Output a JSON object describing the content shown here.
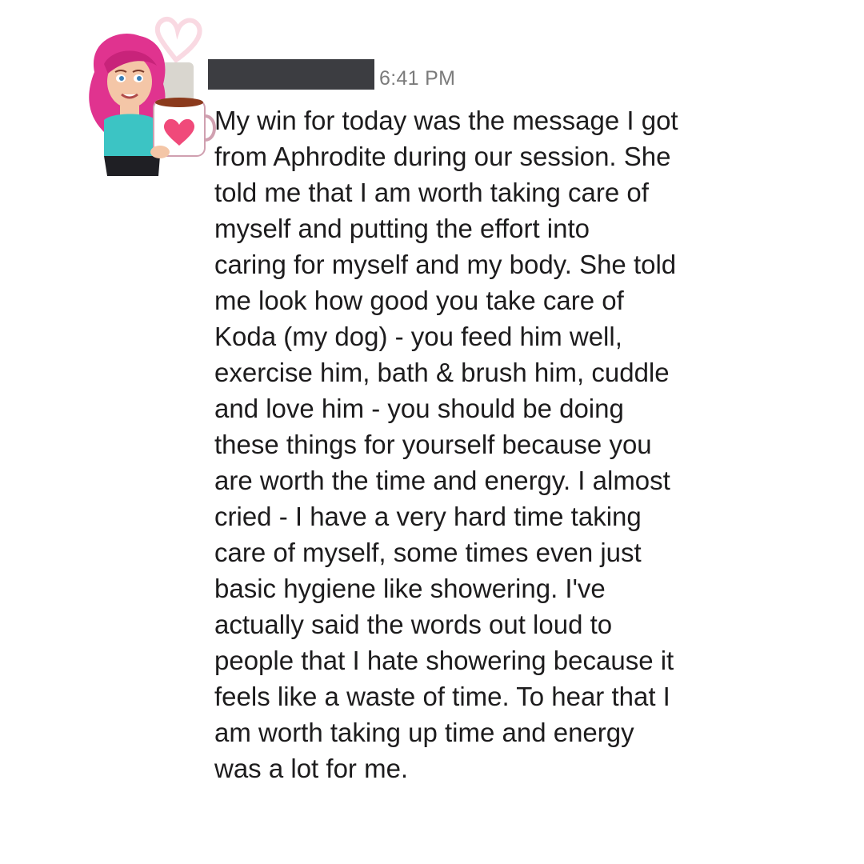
{
  "message": {
    "author_redacted": true,
    "timestamp": "6:41 PM",
    "text": "My win for today was the message I got\nfrom Aphrodite during our session. She\ntold me that I am worth taking care of\nmyself and putting the effort into\ncaring for myself and my body. She told\nme look how good you take care of\nKoda (my dog) - you feed him well,\nexercise him, bath & brush him, cuddle\nand love him - you should be doing\nthese things for yourself because you\nare worth the time and energy. I almost\ncried - I have a very hard time taking\ncare of myself, some times even just\nbasic hygiene like showering. I've\nactually said the words out loud to\npeople that I hate showering because it\nfeels like a waste of time. To hear that I\nam worth taking up time and energy\nwas a lot for me."
  },
  "colors": {
    "text": "#1d1c1d",
    "timestamp": "#7b7b7b",
    "redaction": "#3c3d41",
    "hair": "#e0338f",
    "heart": "#f04a7a"
  },
  "icons": {
    "avatar": "bitmoji-avatar-with-heart-mug",
    "decoration": "heart-outline-icon"
  }
}
